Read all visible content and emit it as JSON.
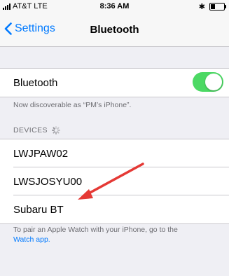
{
  "status_bar": {
    "carrier": "AT&T",
    "network": "LTE",
    "time": "8:36 AM",
    "battery_level": 0.35
  },
  "nav": {
    "back_label": "Settings",
    "title": "Bluetooth"
  },
  "bluetooth": {
    "label": "Bluetooth",
    "enabled": true,
    "toggle_color": "#4cd964"
  },
  "discoverable_text": "Now discoverable as “PM’s iPhone”.",
  "devices": {
    "header": "DEVICES",
    "items": [
      {
        "name": "LWJPAW02"
      },
      {
        "name": "LWSJOSYU00"
      },
      {
        "name": "Subaru BT"
      }
    ]
  },
  "footer": {
    "text": "To pair an Apple Watch with your iPhone, go to the",
    "link_label": "Watch app."
  },
  "colors": {
    "accent": "#007aff",
    "annotation_arrow": "#e53935"
  }
}
